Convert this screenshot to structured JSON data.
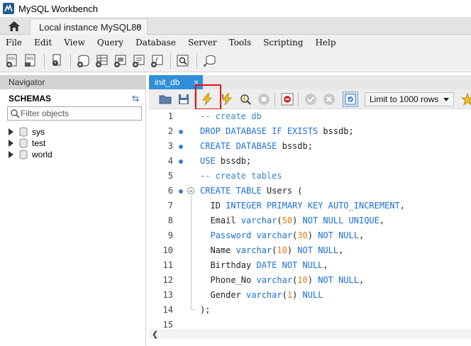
{
  "window": {
    "title": "MySQL Workbench"
  },
  "connection_tab": {
    "label": "Local instance MySQL80",
    "close": "×"
  },
  "menu": [
    "File",
    "Edit",
    "View",
    "Query",
    "Database",
    "Server",
    "Tools",
    "Scripting",
    "Help"
  ],
  "navigator": {
    "header": "Navigator",
    "schemas_label": "SCHEMAS",
    "filter_placeholder": "Filter objects",
    "schemas": [
      "sys",
      "test",
      "world"
    ]
  },
  "editor": {
    "tab_label": "init_db",
    "tab_close": "×",
    "limit_select": "Limit to 1000 rows",
    "lines": [
      {
        "n": "1",
        "dot": false,
        "tokens": [
          [
            "cm",
            "-- create db"
          ]
        ]
      },
      {
        "n": "2",
        "dot": true,
        "tokens": [
          [
            "kw",
            "DROP DATABASE IF EXISTS"
          ],
          [
            "id",
            " bssdb;"
          ]
        ]
      },
      {
        "n": "3",
        "dot": true,
        "tokens": [
          [
            "kw",
            "CREATE DATABASE"
          ],
          [
            "id",
            " bssdb;"
          ]
        ]
      },
      {
        "n": "4",
        "dot": true,
        "tokens": [
          [
            "kw",
            "USE"
          ],
          [
            "id",
            " bssdb;"
          ]
        ]
      },
      {
        "n": "5",
        "dot": false,
        "tokens": [
          [
            "cm",
            "-- create tables"
          ]
        ]
      },
      {
        "n": "6",
        "dot": true,
        "tokens": [
          [
            "kw",
            "CREATE TABLE"
          ],
          [
            "id",
            " Users ("
          ]
        ]
      },
      {
        "n": "7",
        "dot": false,
        "tokens": [
          [
            "id",
            "  ID "
          ],
          [
            "kw",
            "INTEGER PRIMARY KEY AUTO_INCREMENT"
          ],
          [
            "id",
            ","
          ]
        ]
      },
      {
        "n": "8",
        "dot": false,
        "tokens": [
          [
            "id",
            "  Email "
          ],
          [
            "kw",
            "varchar"
          ],
          [
            "id",
            "("
          ],
          [
            "num",
            "50"
          ],
          [
            "id",
            ") "
          ],
          [
            "kw",
            "NOT NULL UNIQUE"
          ],
          [
            "id",
            ","
          ]
        ]
      },
      {
        "n": "9",
        "dot": false,
        "tokens": [
          [
            "kw",
            "  Password varchar"
          ],
          [
            "id",
            "("
          ],
          [
            "num",
            "30"
          ],
          [
            "id",
            ") "
          ],
          [
            "kw",
            "NOT NULL"
          ],
          [
            "id",
            ","
          ]
        ]
      },
      {
        "n": "10",
        "dot": false,
        "tokens": [
          [
            "id",
            "  Name "
          ],
          [
            "kw",
            "varchar"
          ],
          [
            "id",
            "("
          ],
          [
            "num",
            "10"
          ],
          [
            "id",
            ") "
          ],
          [
            "kw",
            "NOT NULL"
          ],
          [
            "id",
            ","
          ]
        ]
      },
      {
        "n": "11",
        "dot": false,
        "tokens": [
          [
            "id",
            "  Birthday "
          ],
          [
            "kw",
            "DATE NOT NULL"
          ],
          [
            "id",
            ","
          ]
        ]
      },
      {
        "n": "12",
        "dot": false,
        "tokens": [
          [
            "id",
            "  Phone_No "
          ],
          [
            "kw",
            "varchar"
          ],
          [
            "id",
            "("
          ],
          [
            "num",
            "10"
          ],
          [
            "id",
            ") "
          ],
          [
            "kw",
            "NOT NULL"
          ],
          [
            "id",
            ","
          ]
        ]
      },
      {
        "n": "13",
        "dot": false,
        "tokens": [
          [
            "id",
            "  Gender "
          ],
          [
            "kw",
            "varchar"
          ],
          [
            "id",
            "("
          ],
          [
            "num",
            "1"
          ],
          [
            "id",
            ") "
          ],
          [
            "kw",
            "NULL"
          ]
        ]
      },
      {
        "n": "14",
        "dot": false,
        "tokens": [
          [
            "id",
            ");"
          ]
        ]
      },
      {
        "n": "15",
        "dot": false,
        "tokens": []
      }
    ]
  },
  "colors": {
    "keyword": "#1c6fd6",
    "comment": "#3b85c6",
    "number": "#e07b16",
    "tab_active": "#2f8fd8",
    "highlight": "#e01515"
  }
}
